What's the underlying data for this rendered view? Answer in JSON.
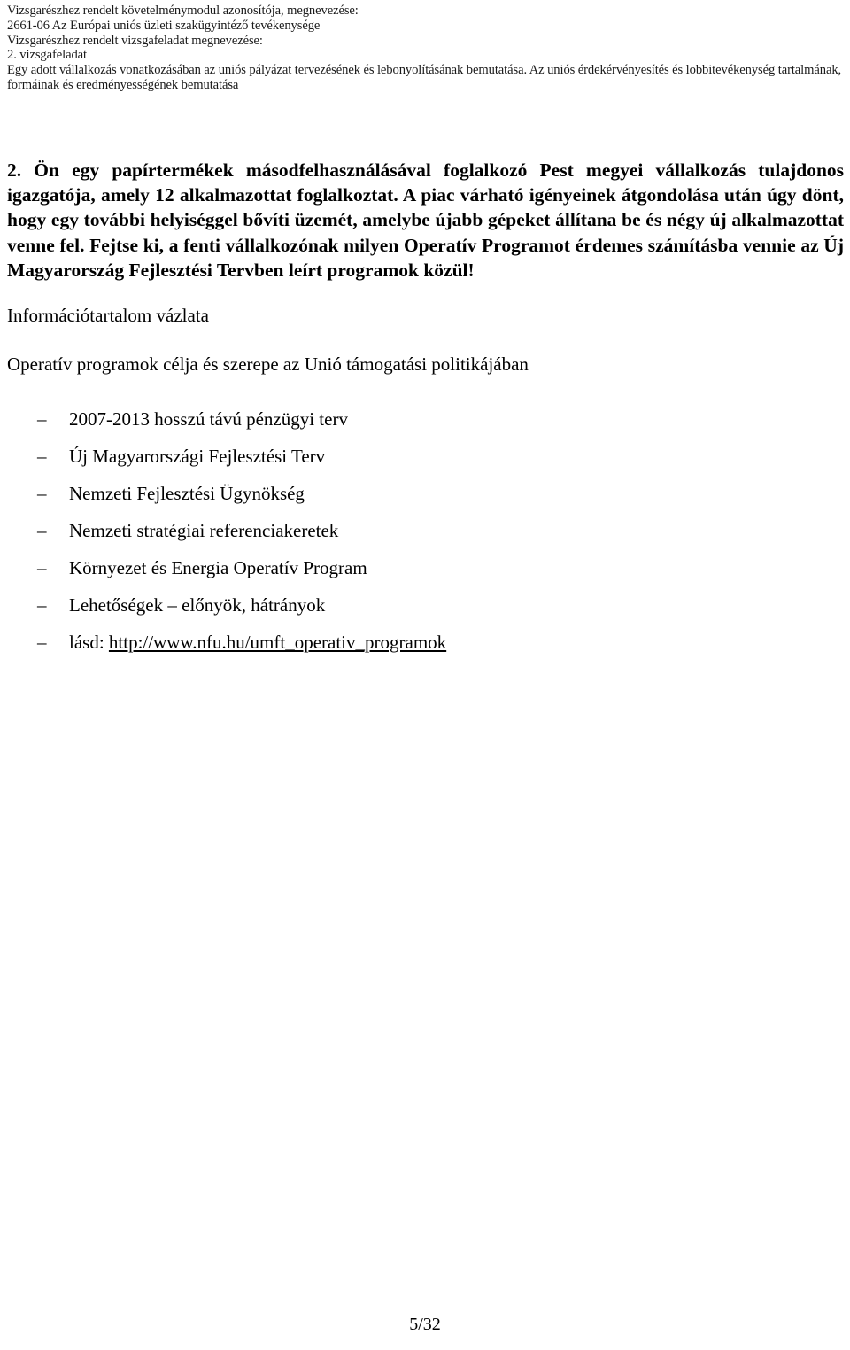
{
  "header": {
    "lines": [
      "Vizsgarészhez rendelt követelménymodul azonosítója, megnevezése:",
      "2661-06 Az Európai uniós üzleti szakügyintéző tevékenysége",
      "Vizsgarészhez rendelt vizsgafeladat megnevezése:",
      "2. vizsgafeladat"
    ],
    "description": "Egy adott vállalkozás vonatkozásában az uniós pályázat tervezésének és lebonyolításának bemutatása. Az uniós érdekérvényesítés és lobbitevékenység tartalmának, formáinak és eredményességének bemutatása"
  },
  "question": {
    "number": "2.",
    "text": "Ön egy papírtermékek másodfelhasználásával foglalkozó Pest megyei vállalkozás tulajdonos igazgatója, amely 12 alkalmazottat foglalkoztat. A piac várható igényeinek átgondolása után úgy dönt, hogy egy további helyiséggel bővíti üzemét, amelybe újabb gépeket állítana be és négy új alkalmazottat venne fel. Fejtse ki, a fenti vállalkozónak milyen Operatív Programot érdemes számításba vennie az Új Magyarország Fejlesztési Tervben leírt programok közül!"
  },
  "info": {
    "heading": "Információtartalom vázlata",
    "subheading": "Operatív programok célja és szerepe az Unió támogatási politikájában",
    "bullet_marker": "–",
    "items": [
      {
        "text": "2007-2013 hosszú távú pénzügyi terv"
      },
      {
        "text": "Új Magyarországi Fejlesztési Terv"
      },
      {
        "text": "Nemzeti Fejlesztési Ügynökség"
      },
      {
        "text": "Nemzeti stratégiai referenciakeretek"
      },
      {
        "text": "Környezet és Energia Operatív Program"
      },
      {
        "text": "Lehetőségek – előnyök, hátrányok"
      }
    ],
    "link_item": {
      "prefix": "lásd: ",
      "url": "http://www.nfu.hu/umft_operativ_programok"
    }
  },
  "footer": {
    "page_number": "5/32"
  }
}
